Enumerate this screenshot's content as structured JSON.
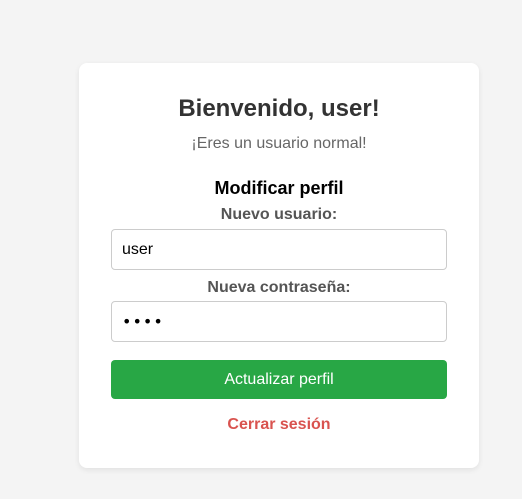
{
  "welcome": {
    "title": "Bienvenido, user!",
    "subtitle": "¡Eres un usuario normal!"
  },
  "profile_form": {
    "heading": "Modificar perfil",
    "username_label": "Nuevo usuario:",
    "username_value": "user",
    "password_label": "Nueva contraseña:",
    "password_value": "••••",
    "submit_label": "Actualizar perfil"
  },
  "logout": {
    "label": "Cerrar sesión"
  },
  "colors": {
    "submit_button": "#28a745",
    "logout_link": "#d9534f"
  }
}
